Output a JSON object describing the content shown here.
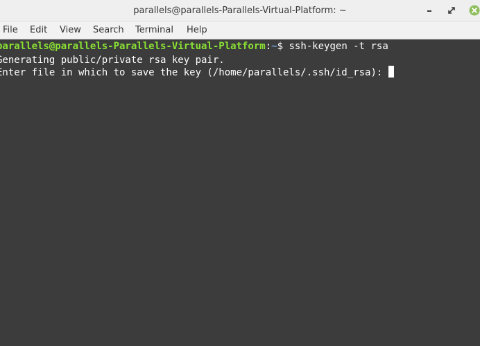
{
  "window": {
    "title": "parallels@parallels-Parallels-Virtual-Platform: ~"
  },
  "controls": {
    "minimize_icon": "minimize-icon",
    "maximize_icon": "maximize-icon",
    "close_icon": "close-icon",
    "close_color": "#8fbf5d"
  },
  "menubar": {
    "items": [
      "File",
      "Edit",
      "View",
      "Search",
      "Terminal",
      "Help"
    ]
  },
  "terminal": {
    "lines": [
      {
        "prompt_user": "parallels@parallels-Parallels-Virtual-Platform",
        "prompt_sep": ":",
        "prompt_path": "~",
        "prompt_symbol": "$ ",
        "command": "ssh-keygen -t rsa"
      },
      {
        "text": "Generating public/private rsa key pair."
      },
      {
        "text": "Enter file in which to save the key (/home/parallels/.ssh/id_rsa): "
      }
    ],
    "colors": {
      "background": "#3c3c3c",
      "foreground": "#ffffff",
      "prompt_user": "#8ae234",
      "prompt_path": "#729fcf"
    }
  }
}
